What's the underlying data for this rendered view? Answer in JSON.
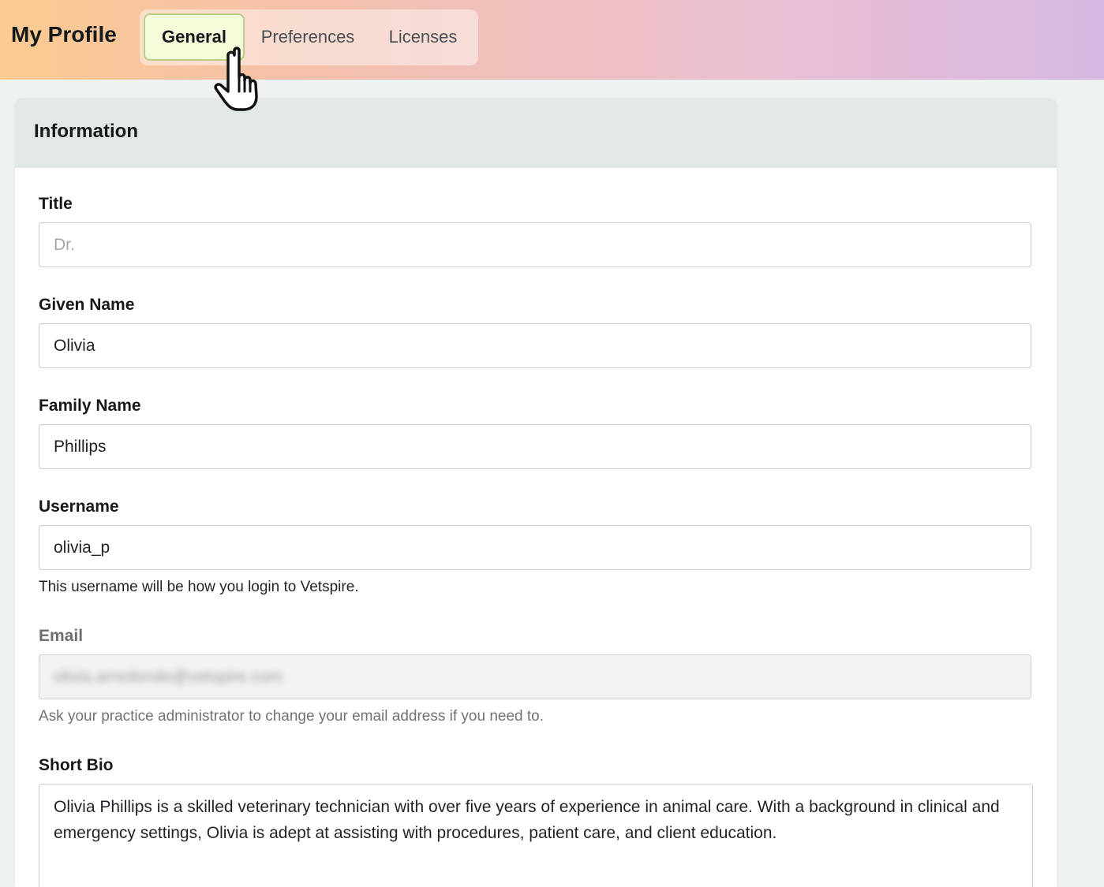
{
  "header": {
    "title": "My Profile",
    "tabs": [
      {
        "label": "General",
        "active": true
      },
      {
        "label": "Preferences",
        "active": false
      },
      {
        "label": "Licenses",
        "active": false
      }
    ]
  },
  "section": {
    "title": "Information"
  },
  "form": {
    "title": {
      "label": "Title",
      "placeholder": "Dr.",
      "value": ""
    },
    "given_name": {
      "label": "Given Name",
      "value": "Olivia"
    },
    "family_name": {
      "label": "Family Name",
      "value": "Phillips"
    },
    "username": {
      "label": "Username",
      "value": "olivia_p",
      "help": "This username will be how you login to Vetspire."
    },
    "email": {
      "label": "Email",
      "value": "olivia.arredondo@vetspire.com",
      "help": "Ask your practice administrator to change your email address if you need to.",
      "disabled": true
    },
    "bio": {
      "label": "Short Bio",
      "value": "Olivia Phillips is a skilled veterinary technician with over five years of experience in animal care. With a background in clinical and emergency settings, Olivia is adept at assisting with procedures, patient care, and client education."
    }
  },
  "icons": {
    "cursor": "hand-pointer-icon"
  }
}
